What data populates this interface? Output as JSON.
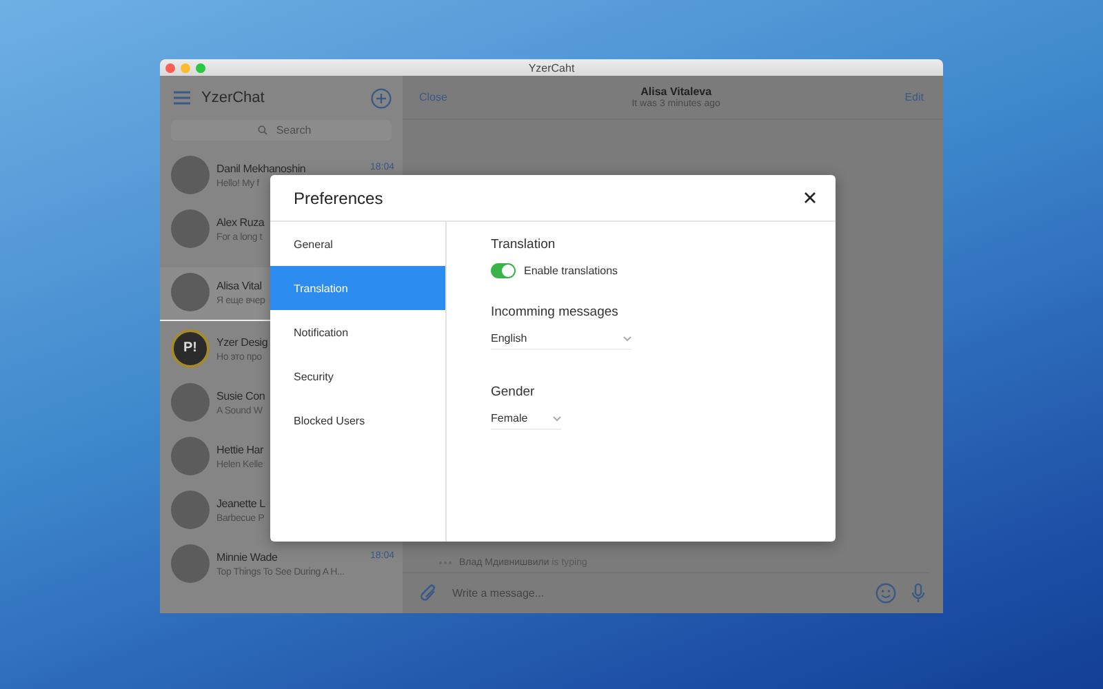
{
  "window": {
    "title": "YzerCaht"
  },
  "sidebar": {
    "title": "YzerChat",
    "search": {
      "placeholder": "Search"
    },
    "chats": [
      {
        "name": "Danil Mekhanoshin",
        "preview": "Hello! My f",
        "time": "18:04",
        "selected": false,
        "avatar": {
          "kind": "photo"
        }
      },
      {
        "name": "Alex Ruza",
        "preview": "For a long t",
        "selected": false,
        "avatar": {
          "kind": "photo"
        }
      },
      {
        "name": "Alisa Vital",
        "preview": "Я еще вчер",
        "selected": true,
        "avatar": {
          "kind": "photo"
        }
      },
      {
        "name": "Yzer Desig",
        "preview": "Но это про",
        "selected": false,
        "avatar": {
          "kind": "logo",
          "text": "P!"
        }
      },
      {
        "name": "Susie Con",
        "preview": "A Sound W",
        "selected": false,
        "avatar": {
          "kind": "photo"
        }
      },
      {
        "name": "Hettie Har",
        "preview": "Helen Kelle",
        "selected": false,
        "avatar": {
          "kind": "photo"
        }
      },
      {
        "name": "Jeanette L",
        "preview": "Barbecue P",
        "selected": false,
        "avatar": {
          "kind": "photo"
        }
      },
      {
        "name": "Minnie Wade",
        "preview": "Top Things To See During A H...",
        "time": "18:04",
        "selected": false,
        "avatar": {
          "kind": "photo"
        }
      }
    ]
  },
  "chat": {
    "close": "Close",
    "name": "Alisa Vitaleva",
    "status": "It was 3 minutes ago",
    "edit": "Edit",
    "typing": {
      "name": "Влад Мдивнишвили",
      "text": "is typing"
    },
    "composer": {
      "placeholder": "Write a message..."
    }
  },
  "preferences": {
    "title": "Preferences",
    "nav": [
      {
        "label": "General",
        "selected": false
      },
      {
        "label": "Translation",
        "selected": true
      },
      {
        "label": "Notification",
        "selected": false
      },
      {
        "label": "Security",
        "selected": false
      },
      {
        "label": "Blocked Users",
        "selected": false
      }
    ],
    "translation": {
      "heading": "Translation",
      "toggle": {
        "label": "Enable translations",
        "on": true
      }
    },
    "incoming": {
      "heading": "Incomming messages",
      "value": "English"
    },
    "gender": {
      "heading": "Gender",
      "value": "Female"
    }
  }
}
